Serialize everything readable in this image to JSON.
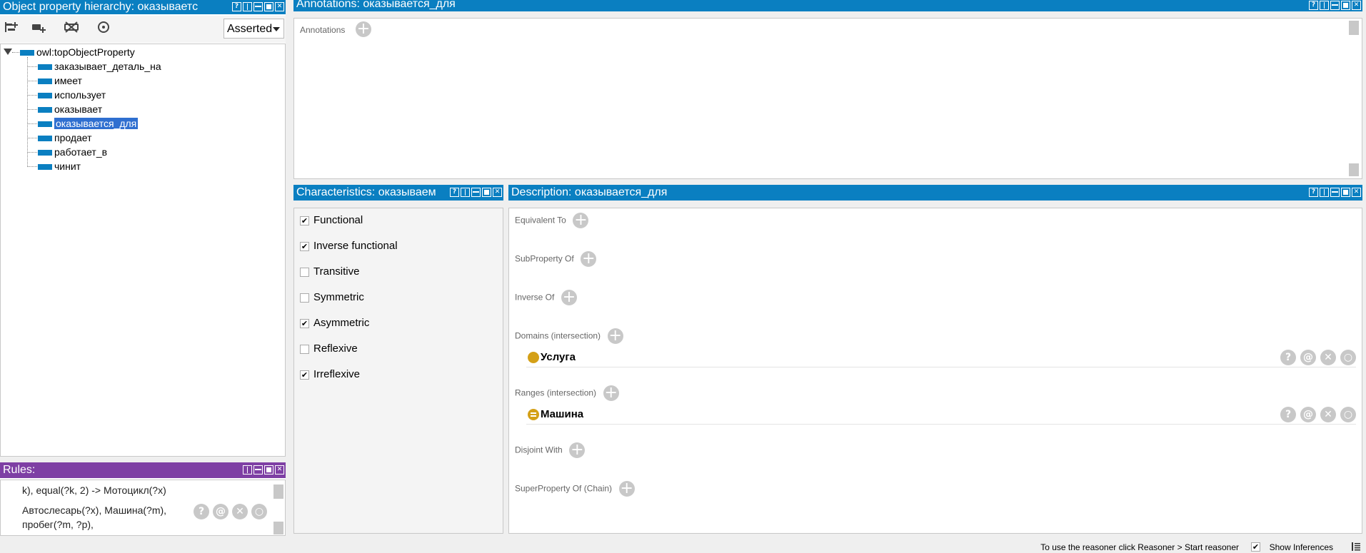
{
  "hierarchy": {
    "title": "Object property hierarchy: оказываетс",
    "mode": "Asserted",
    "root": "owl:topObjectProperty",
    "items": [
      "заказывает_деталь_на",
      "имеет",
      "использует",
      "оказывает",
      "оказывается_для",
      "продает",
      "работает_в",
      "чинит"
    ],
    "selected_index": 4,
    "toolbar_icons": [
      "add-sub-property-icon",
      "add-sibling-property-icon",
      "delete-property-icon",
      "find-usage-icon"
    ]
  },
  "rules": {
    "title": "Rules:",
    "line1": "k), equal(?k, 2) -> Мотоцикл(?x)",
    "rule2_line1": "Автослесарь(?x), Машина(?m),",
    "rule2_line2": "пробег(?m, ?p),"
  },
  "annotations": {
    "title": "Annotations: оказывается_для",
    "label": "Annotations"
  },
  "characteristics": {
    "title": "Characteristics: оказываем",
    "items": [
      {
        "label": "Functional",
        "checked": true
      },
      {
        "label": "Inverse functional",
        "checked": true
      },
      {
        "label": "Transitive",
        "checked": false
      },
      {
        "label": "Symmetric",
        "checked": false
      },
      {
        "label": "Asymmetric",
        "checked": true
      },
      {
        "label": "Reflexive",
        "checked": false
      },
      {
        "label": "Irreflexive",
        "checked": true
      }
    ]
  },
  "description": {
    "title": "Description: оказывается_для",
    "equivalent_to": "Equivalent To",
    "subproperty_of": "SubProperty Of",
    "inverse_of": "Inverse Of",
    "domains": "Domains (intersection)",
    "domain_entity": "Услуга",
    "ranges": "Ranges (intersection)",
    "range_entity": "Машина",
    "disjoint_with": "Disjoint With",
    "superproperty_chain": "SuperProperty Of (Chain)"
  },
  "status": {
    "message": "To use the reasoner click Reasoner > Start reasoner",
    "show_inferences": "Show Inferences",
    "show_inferences_checked": true
  },
  "colors": {
    "title_blue": "#0a7fc1",
    "title_purple": "#7e3fa4",
    "class_gold": "#d4a017",
    "selection": "#2f6fd0"
  }
}
